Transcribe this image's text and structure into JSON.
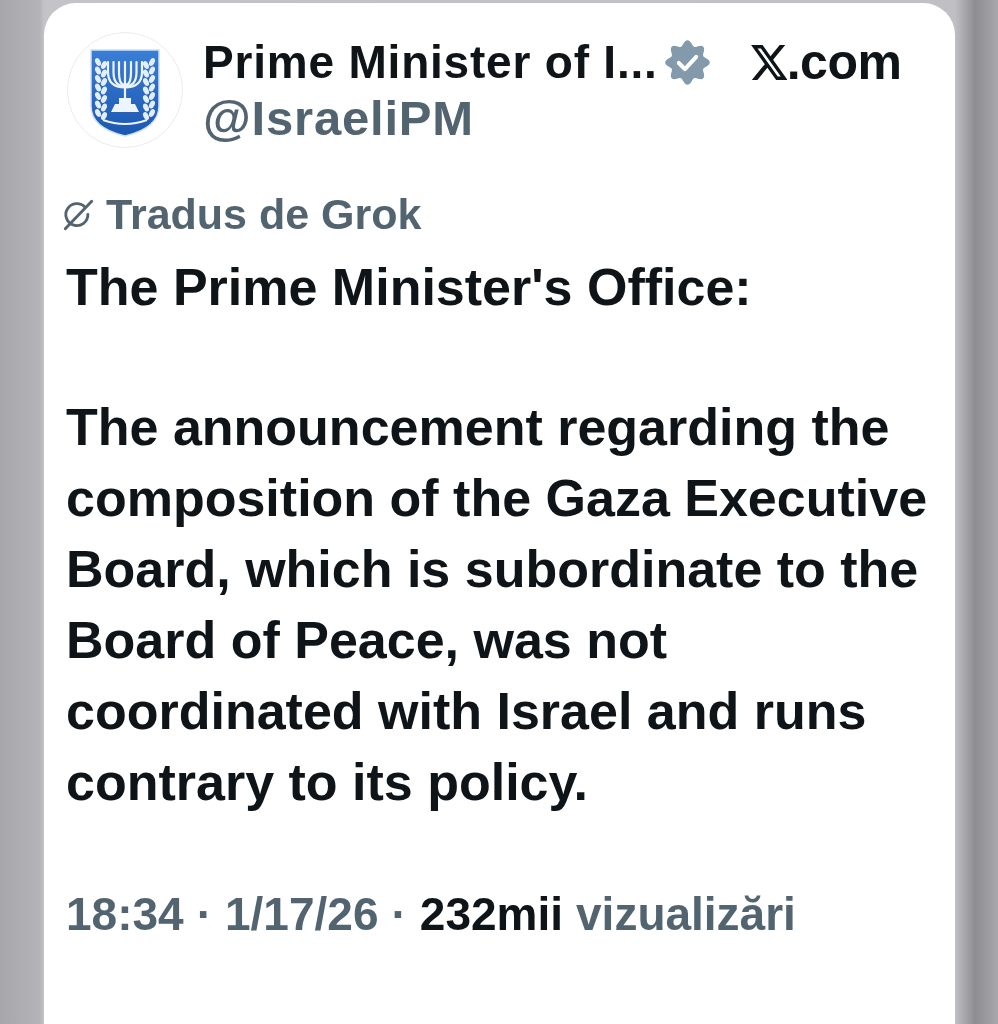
{
  "post": {
    "author": {
      "name": "Prime Minister of I...",
      "verified": true,
      "handle": "@IsraeliPM"
    },
    "source": ".com",
    "translation": {
      "label": "Tradus de Grok"
    },
    "body": [
      "The Prime Minister's Office:",
      "The announcement regarding the composition of the Gaza Executive Board, which is subordinate to the Board of Peace, was not coordinated with Israel and runs contrary to its policy."
    ],
    "meta": [
      {
        "kind": "muted",
        "text": "18:34"
      },
      {
        "kind": "muted",
        "text": "·"
      },
      {
        "kind": "muted",
        "text": "1/17/26"
      },
      {
        "kind": "muted",
        "text": "·"
      },
      {
        "kind": "strong",
        "text": "232mii"
      },
      {
        "kind": "muted",
        "text": "vizualizări"
      }
    ]
  }
}
